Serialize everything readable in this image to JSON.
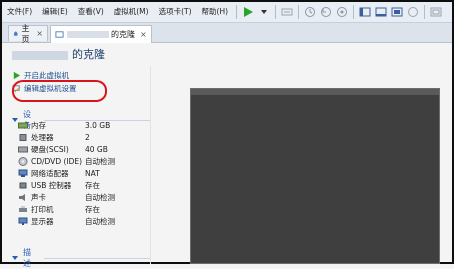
{
  "menubar": {
    "items": [
      "文件(F)",
      "编辑(E)",
      "查看(V)",
      "虚拟机(M)",
      "选项卡(T)",
      "帮助(H)"
    ]
  },
  "tabs": [
    {
      "label": "主页",
      "icon": "home-icon"
    },
    {
      "label": "的克隆",
      "icon": "vm-icon"
    }
  ],
  "title": {
    "text": "的克隆"
  },
  "actions": [
    {
      "label": "开启此虚拟机",
      "icon": "play-icon"
    },
    {
      "label": "编辑虚拟机设置",
      "icon": "edit-vm-icon"
    }
  ],
  "devices_section": {
    "label": "设备"
  },
  "devices": [
    {
      "name": "内存",
      "value": "3.0 GB",
      "icon": "memory-icon"
    },
    {
      "name": "处理器",
      "value": "2",
      "icon": "cpu-icon"
    },
    {
      "name": "硬盘(SCSI)",
      "value": "40 GB",
      "icon": "disk-icon"
    },
    {
      "name": "CD/DVD (IDE)",
      "value": "自动检测",
      "icon": "cd-icon"
    },
    {
      "name": "网络适配器",
      "value": "NAT",
      "icon": "network-icon"
    },
    {
      "name": "USB 控制器",
      "value": "存在",
      "icon": "usb-icon"
    },
    {
      "name": "声卡",
      "value": "自动检测",
      "icon": "sound-icon"
    },
    {
      "name": "打印机",
      "value": "存在",
      "icon": "printer-icon"
    },
    {
      "name": "显示器",
      "value": "自动检测",
      "icon": "display-icon"
    }
  ],
  "description_section": {
    "label": "描述"
  },
  "colors": {
    "accent": "#2a5db0",
    "highlight": "#d6161c",
    "play": "#2aa52a"
  }
}
